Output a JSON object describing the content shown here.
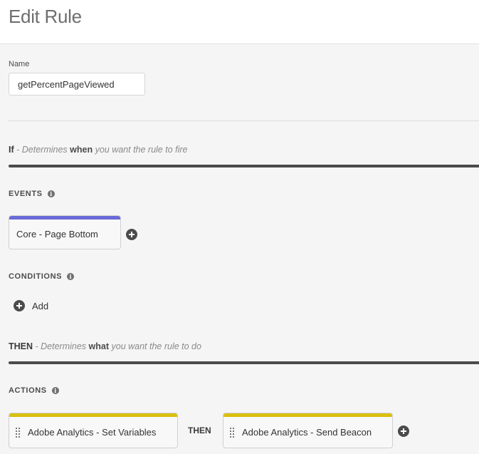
{
  "header": {
    "title": "Edit Rule"
  },
  "name_field": {
    "label": "Name",
    "value": "getPercentPageViewed"
  },
  "if_section": {
    "keyword": "If",
    "prefix": " - Determines ",
    "emphasis": "when",
    "suffix": " you want the rule to fire"
  },
  "events": {
    "label": "EVENTS",
    "info_icon": "info-icon",
    "items": [
      {
        "label": "Core - Page Bottom",
        "accent_color": "#6a6ad8"
      }
    ]
  },
  "conditions": {
    "label": "CONDITIONS",
    "add_label": "Add"
  },
  "then_section": {
    "keyword": "THEN",
    "prefix": " - Determines ",
    "emphasis": "what",
    "suffix": " you want the rule to do"
  },
  "actions": {
    "label": "ACTIONS",
    "connector": "THEN",
    "items": [
      {
        "label": "Adobe Analytics - Set Variables",
        "accent_color": "#d9c00f"
      },
      {
        "label": "Adobe Analytics - Send Beacon",
        "accent_color": "#d9c00f"
      }
    ]
  },
  "icons": {
    "add": "plus-circle-icon",
    "drag": "drag-handle-icon",
    "info": "info-icon"
  }
}
